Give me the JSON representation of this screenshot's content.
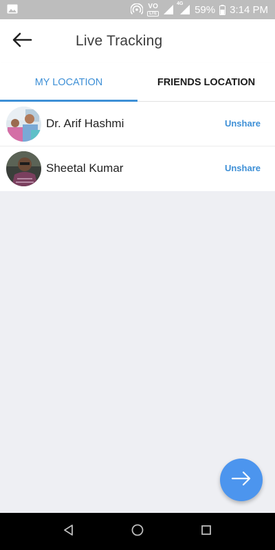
{
  "status_bar": {
    "battery": "59%",
    "time": "3:14 PM",
    "volte": "VO",
    "lte": "LTE",
    "network": "4G",
    "icons": [
      "image-icon",
      "hotspot-icon",
      "volte-icon",
      "signal-icon",
      "signal-4g-icon",
      "battery-icon"
    ]
  },
  "app_bar": {
    "title": "Live Tracking",
    "back_icon": "arrow-left-icon"
  },
  "tabs": [
    {
      "label": "MY LOCATION",
      "active": true
    },
    {
      "label": "FRIENDS LOCATION",
      "active": false
    }
  ],
  "contacts": [
    {
      "name": "Dr. Arif Hashmi",
      "action": "Unshare"
    },
    {
      "name": "Sheetal Kumar",
      "action": "Unshare"
    }
  ],
  "fab": {
    "icon": "arrow-right-icon"
  },
  "nav_bar": {
    "icons": [
      "back-triangle-icon",
      "home-circle-icon",
      "recents-square-icon"
    ]
  },
  "colors": {
    "accent": "#3d8fd6",
    "fab": "#4c95ee",
    "background": "#eeeff3",
    "status_bar": "#bdbdbd"
  }
}
